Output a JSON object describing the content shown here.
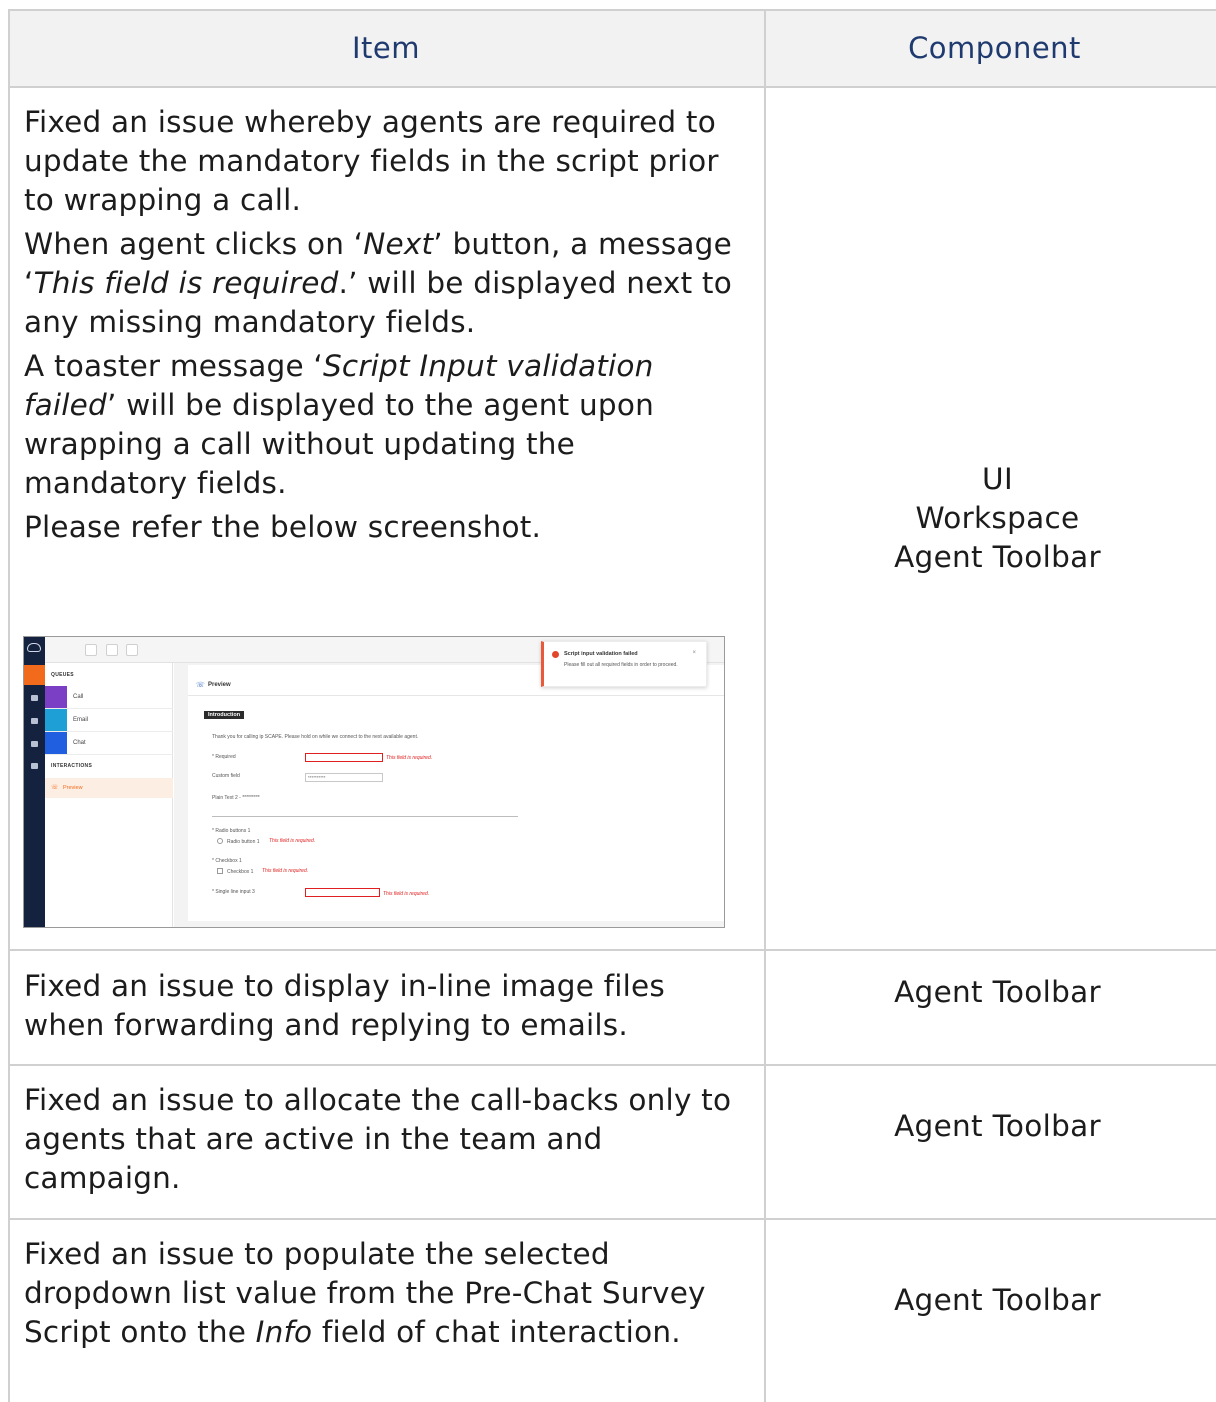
{
  "table": {
    "headers": {
      "item": "Item",
      "component": "Component"
    },
    "rows": [
      {
        "item_paragraphs": [
          [
            {
              "t": "Fixed an issue whereby agents are required to update the mandatory fields in the script prior to wrapping a call."
            }
          ],
          [
            {
              "t": "When agent clicks on ‘"
            },
            {
              "t": "Next",
              "i": true
            },
            {
              "t": "’ button, a message ‘"
            },
            {
              "t": "This field is required",
              "i": true
            },
            {
              "t": ".’ will be displayed next to any missing mandatory fields."
            }
          ],
          [
            {
              "t": "A toaster message ‘"
            },
            {
              "t": "Script Input validation failed",
              "i": true
            },
            {
              "t": "’ will be displayed to the agent upon wrapping a call without updating the mandatory fields."
            }
          ],
          [
            {
              "t": "Please refer the below screenshot."
            }
          ]
        ],
        "components": [
          "UI",
          "Workspace",
          "Agent Toolbar"
        ]
      },
      {
        "item_paragraphs": [
          [
            {
              "t": "Fixed an issue to display in-line image files when forwarding and replying to emails."
            }
          ]
        ],
        "components": [
          "Agent Toolbar"
        ]
      },
      {
        "item_paragraphs": [
          [
            {
              "t": "Fixed an issue to allocate the call-backs only to agents that are active in the team and campaign."
            }
          ]
        ],
        "components": [
          "Agent Toolbar"
        ]
      },
      {
        "item_paragraphs": [
          [
            {
              "t": "Fixed an issue to populate the selected dropdown list value from the Pre-Chat Survey Script onto the "
            },
            {
              "t": "Info",
              "i": true
            },
            {
              "t": " field of chat interaction."
            }
          ]
        ],
        "components": [
          "Agent Toolbar"
        ]
      }
    ]
  },
  "screenshot": {
    "queues_label": "QUEUES",
    "queue_items": [
      "Call",
      "Email",
      "Chat"
    ],
    "interactions_label": "INTERACTIONS",
    "interaction_item": "Preview",
    "panel_title": "Preview",
    "section_tag": "Introduction",
    "intro_text": "Thank you for calling ip SCAPE. Please hold on while we connect to the next available agent.",
    "fields": {
      "required_label": "* Required",
      "required_error": "This field is required.",
      "custom_label": "Custom field",
      "custom_value": "**********",
      "plain_text": "Plain Text 2 - *********",
      "radio_group_label": "* Radio buttons 1",
      "radio_option": "Radio button 1",
      "radio_error": "This field is required.",
      "checkbox_group_label": "* Checkbox 1",
      "checkbox_option": "Checkbox 1",
      "checkbox_error": "This field is required.",
      "single_line_label": "* Single line input 3",
      "single_line_error": "This field is required."
    },
    "toast": {
      "title": "Script input validation failed",
      "body": "Please fill out all required fields in order to proceed.",
      "close": "×"
    },
    "colors": {
      "rail": "#15223f",
      "accent": "#f26a1b",
      "error": "#e02020",
      "call": "#7b3fc6",
      "email": "#1e9fd6",
      "chat": "#1f5fe0"
    }
  }
}
